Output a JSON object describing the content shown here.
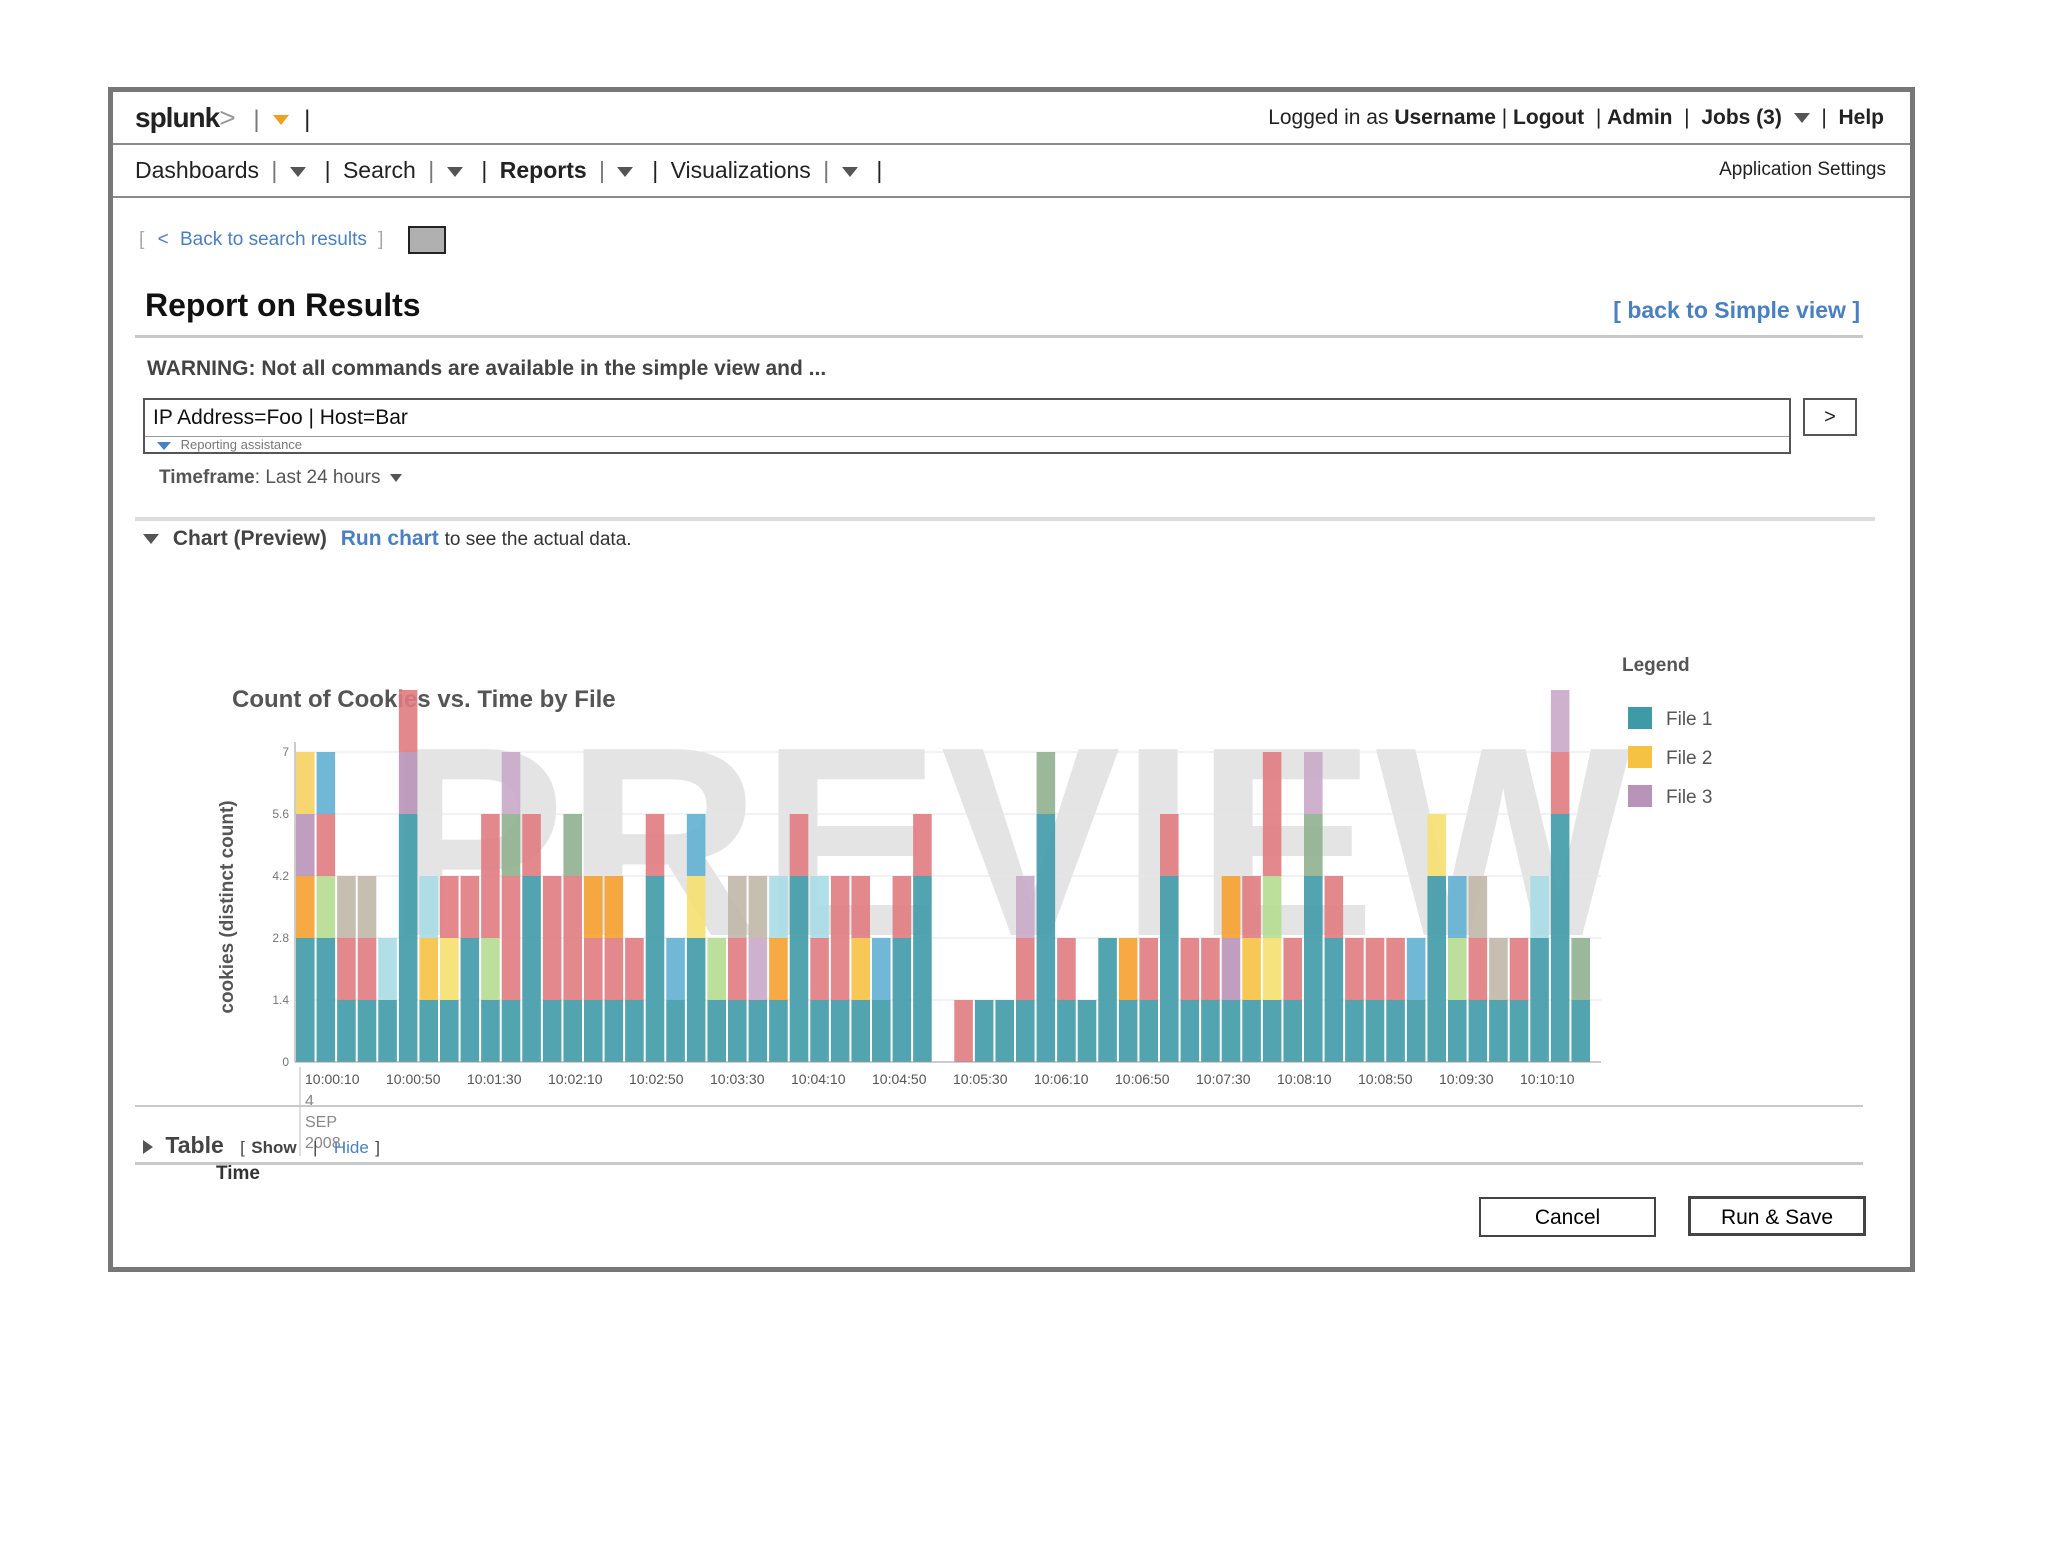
{
  "header": {
    "logo": "splunk",
    "logo_suffix": ">",
    "logged_in_prefix": "Logged in as",
    "username": "Username",
    "logout": "Logout",
    "admin": "Admin",
    "jobs": "Jobs (3)",
    "help": "Help"
  },
  "nav": {
    "items": [
      {
        "label": "Dashboards"
      },
      {
        "label": "Search"
      },
      {
        "label": "Reports"
      },
      {
        "label": "Visualizations"
      }
    ],
    "app_settings": "Application Settings"
  },
  "page": {
    "back_link": "Back to search results",
    "title": "Report on Results",
    "simple_view": "back to Simple view",
    "warning": "WARNING: Not all commands are available in the simple view and ..."
  },
  "search": {
    "value": "IP Address=Foo | Host=Bar",
    "assist": "Reporting assistance",
    "go": ">"
  },
  "timeframe": {
    "label": "Timeframe",
    "value": "Last 24 hours"
  },
  "chart_section": {
    "title": "Chart (Preview)",
    "run_chart": "Run chart",
    "hint": "to see the actual data."
  },
  "colors": {
    "file1": "#3f9aa8",
    "file2": "#f6c244",
    "file3": "#b894b8",
    "red": "#e07b80",
    "watermark": "#dcdcdc"
  },
  "chart_data": {
    "type": "bar",
    "stacked": true,
    "title": "Count of Cookies vs. Time by File",
    "watermark": "PREVIEW",
    "xlabel": "Time",
    "ylabel": "cookies (distinct count)",
    "ylim": [
      0,
      7
    ],
    "yticks": [
      "0",
      "1.4",
      "2.8",
      "4.2",
      "5.6",
      "7"
    ],
    "xticks": [
      "10:00:10",
      "10:00:50",
      "10:01:30",
      "10:02:10",
      "10:02:50",
      "10:03:30",
      "10:04:10",
      "10:04:50",
      "10:05:30",
      "10:06:10",
      "10:06:50",
      "10:07:30",
      "10:08:10",
      "10:08:50",
      "10:09:30",
      "10:10:10"
    ],
    "date_label": [
      "4",
      "SEP",
      "2008"
    ],
    "legend_title": "Legend",
    "legend_position": "right",
    "series_names": [
      "File 1",
      "File 2",
      "File 3"
    ],
    "bars": [
      [
        [
          2,
          "#3f9aa8"
        ],
        [
          1,
          "#f6a030"
        ],
        [
          1,
          "#b894b8"
        ],
        [
          1,
          "#f6d060"
        ]
      ],
      [
        [
          2,
          "#3f9aa8"
        ],
        [
          1,
          "#b5dc90"
        ],
        [
          1,
          "#e07b80"
        ],
        [
          1,
          "#60b0d0"
        ]
      ],
      [
        [
          1,
          "#3f9aa8"
        ],
        [
          1,
          "#e07b80"
        ],
        [
          1,
          "#c0b8a8"
        ]
      ],
      [
        [
          1,
          "#3f9aa8"
        ],
        [
          1,
          "#e07b80"
        ],
        [
          1,
          "#c0b8a8"
        ]
      ],
      [
        [
          1,
          "#3f9aa8"
        ],
        [
          1,
          "#a8dce4"
        ]
      ],
      [
        [
          4,
          "#3f9aa8"
        ],
        [
          1,
          "#b894b8"
        ],
        [
          1,
          "#e07b80"
        ]
      ],
      [
        [
          1,
          "#3f9aa8"
        ],
        [
          1,
          "#f6c244"
        ],
        [
          1,
          "#a8dce4"
        ]
      ],
      [
        [
          1,
          "#3f9aa8"
        ],
        [
          1,
          "#f6e070"
        ],
        [
          1,
          "#e07b80"
        ]
      ],
      [
        [
          2,
          "#3f9aa8"
        ],
        [
          1,
          "#e07b80"
        ]
      ],
      [
        [
          1,
          "#3f9aa8"
        ],
        [
          1,
          "#b5dc90"
        ],
        [
          2,
          "#e07b80"
        ]
      ],
      [
        [
          1,
          "#3f9aa8"
        ],
        [
          2,
          "#e07b80"
        ],
        [
          1,
          "#90b090"
        ],
        [
          1,
          "#c8a8c8"
        ]
      ],
      [
        [
          3,
          "#3f9aa8"
        ],
        [
          1,
          "#e07b80"
        ]
      ],
      [
        [
          1,
          "#3f9aa8"
        ],
        [
          2,
          "#e07b80"
        ]
      ],
      [
        [
          1,
          "#3f9aa8"
        ],
        [
          2,
          "#e07b80"
        ],
        [
          1,
          "#90b090"
        ]
      ],
      [
        [
          1,
          "#3f9aa8"
        ],
        [
          1,
          "#e07b80"
        ],
        [
          1,
          "#f6a030"
        ]
      ],
      [
        [
          1,
          "#3f9aa8"
        ],
        [
          1,
          "#e07b80"
        ],
        [
          1,
          "#f6a030"
        ]
      ],
      [
        [
          1,
          "#3f9aa8"
        ],
        [
          1,
          "#e07b80"
        ]
      ],
      [
        [
          3,
          "#3f9aa8"
        ],
        [
          1,
          "#e07b80"
        ]
      ],
      [
        [
          1,
          "#3f9aa8"
        ],
        [
          1,
          "#60b0d0"
        ]
      ],
      [
        [
          2,
          "#3f9aa8"
        ],
        [
          1,
          "#f6e070"
        ],
        [
          1,
          "#60b0d0"
        ]
      ],
      [
        [
          1,
          "#3f9aa8"
        ],
        [
          1,
          "#b5dc90"
        ]
      ],
      [
        [
          1,
          "#3f9aa8"
        ],
        [
          1,
          "#e07b80"
        ],
        [
          1,
          "#c0b8a8"
        ]
      ],
      [
        [
          1,
          "#3f9aa8"
        ],
        [
          1,
          "#c8a8c8"
        ],
        [
          1,
          "#c0b8a8"
        ]
      ],
      [
        [
          1,
          "#3f9aa8"
        ],
        [
          1,
          "#f6a030"
        ],
        [
          1,
          "#a8dce4"
        ]
      ],
      [
        [
          3,
          "#3f9aa8"
        ],
        [
          1,
          "#e07b80"
        ]
      ],
      [
        [
          1,
          "#3f9aa8"
        ],
        [
          1,
          "#e07b80"
        ],
        [
          1,
          "#a8dce4"
        ]
      ],
      [
        [
          1,
          "#3f9aa8"
        ],
        [
          1,
          "#e07b80"
        ],
        [
          1,
          "#e07b80"
        ]
      ],
      [
        [
          1,
          "#3f9aa8"
        ],
        [
          1,
          "#f6c244"
        ],
        [
          1,
          "#e07b80"
        ]
      ],
      [
        [
          1,
          "#3f9aa8"
        ],
        [
          1,
          "#60b0d0"
        ]
      ],
      [
        [
          2,
          "#3f9aa8"
        ],
        [
          1,
          "#e07b80"
        ]
      ],
      [
        [
          3,
          "#3f9aa8"
        ],
        [
          1,
          "#e07b80"
        ]
      ],
      [
        [
          0,
          "#3f9aa8"
        ]
      ],
      [
        [
          1,
          "#e07b80"
        ]
      ],
      [
        [
          1,
          "#3f9aa8"
        ]
      ],
      [
        [
          1,
          "#3f9aa8"
        ]
      ],
      [
        [
          1,
          "#3f9aa8"
        ],
        [
          1,
          "#e07b80"
        ],
        [
          1,
          "#c8a8c8"
        ]
      ],
      [
        [
          4,
          "#3f9aa8"
        ],
        [
          1,
          "#90b090"
        ]
      ],
      [
        [
          1,
          "#3f9aa8"
        ],
        [
          1,
          "#e07b80"
        ]
      ],
      [
        [
          1,
          "#3f9aa8"
        ]
      ],
      [
        [
          2,
          "#3f9aa8"
        ]
      ],
      [
        [
          1,
          "#3f9aa8"
        ],
        [
          1,
          "#f6a030"
        ]
      ],
      [
        [
          1,
          "#3f9aa8"
        ],
        [
          1,
          "#e07b80"
        ]
      ],
      [
        [
          3,
          "#3f9aa8"
        ],
        [
          1,
          "#e07b80"
        ]
      ],
      [
        [
          1,
          "#3f9aa8"
        ],
        [
          1,
          "#e07b80"
        ]
      ],
      [
        [
          1,
          "#3f9aa8"
        ],
        [
          1,
          "#e07b80"
        ]
      ],
      [
        [
          1,
          "#3f9aa8"
        ],
        [
          1,
          "#b894b8"
        ],
        [
          1,
          "#f6a030"
        ]
      ],
      [
        [
          1,
          "#3f9aa8"
        ],
        [
          1,
          "#f6c244"
        ],
        [
          1,
          "#e07b80"
        ]
      ],
      [
        [
          1,
          "#3f9aa8"
        ],
        [
          1,
          "#f6e070"
        ],
        [
          1,
          "#b5dc90"
        ],
        [
          2,
          "#e07b80"
        ]
      ],
      [
        [
          1,
          "#3f9aa8"
        ],
        [
          1,
          "#e07b80"
        ]
      ],
      [
        [
          3,
          "#3f9aa8"
        ],
        [
          1,
          "#90b090"
        ],
        [
          1,
          "#c8a8c8"
        ]
      ],
      [
        [
          2,
          "#3f9aa8"
        ],
        [
          1,
          "#e07b80"
        ]
      ],
      [
        [
          1,
          "#3f9aa8"
        ],
        [
          1,
          "#e07b80"
        ]
      ],
      [
        [
          1,
          "#3f9aa8"
        ],
        [
          1,
          "#e07b80"
        ]
      ],
      [
        [
          1,
          "#3f9aa8"
        ],
        [
          1,
          "#e07b80"
        ]
      ],
      [
        [
          1,
          "#3f9aa8"
        ],
        [
          1,
          "#60b0d0"
        ]
      ],
      [
        [
          3,
          "#3f9aa8"
        ],
        [
          1,
          "#f6e070"
        ]
      ],
      [
        [
          1,
          "#3f9aa8"
        ],
        [
          1,
          "#b5dc90"
        ],
        [
          1,
          "#60b0d0"
        ]
      ],
      [
        [
          1,
          "#3f9aa8"
        ],
        [
          1,
          "#e07b80"
        ],
        [
          1,
          "#c0b8a8"
        ]
      ],
      [
        [
          1,
          "#3f9aa8"
        ],
        [
          1,
          "#c0b8a8"
        ]
      ],
      [
        [
          1,
          "#3f9aa8"
        ],
        [
          1,
          "#e07b80"
        ]
      ],
      [
        [
          2,
          "#3f9aa8"
        ],
        [
          1,
          "#a8dce4"
        ]
      ],
      [
        [
          4,
          "#3f9aa8"
        ],
        [
          1,
          "#e07b80"
        ],
        [
          1,
          "#c8a8c8"
        ]
      ],
      [
        [
          1,
          "#3f9aa8"
        ],
        [
          1,
          "#90b090"
        ]
      ]
    ],
    "legend": [
      {
        "name": "File 1",
        "color": "#3f9aa8"
      },
      {
        "name": "File 2",
        "color": "#f6c244"
      },
      {
        "name": "File 3",
        "color": "#b894b8"
      }
    ]
  },
  "table_section": {
    "title": "Table",
    "show": "Show",
    "hide": "Hide"
  },
  "buttons": {
    "cancel": "Cancel",
    "run_save": "Run & Save"
  }
}
